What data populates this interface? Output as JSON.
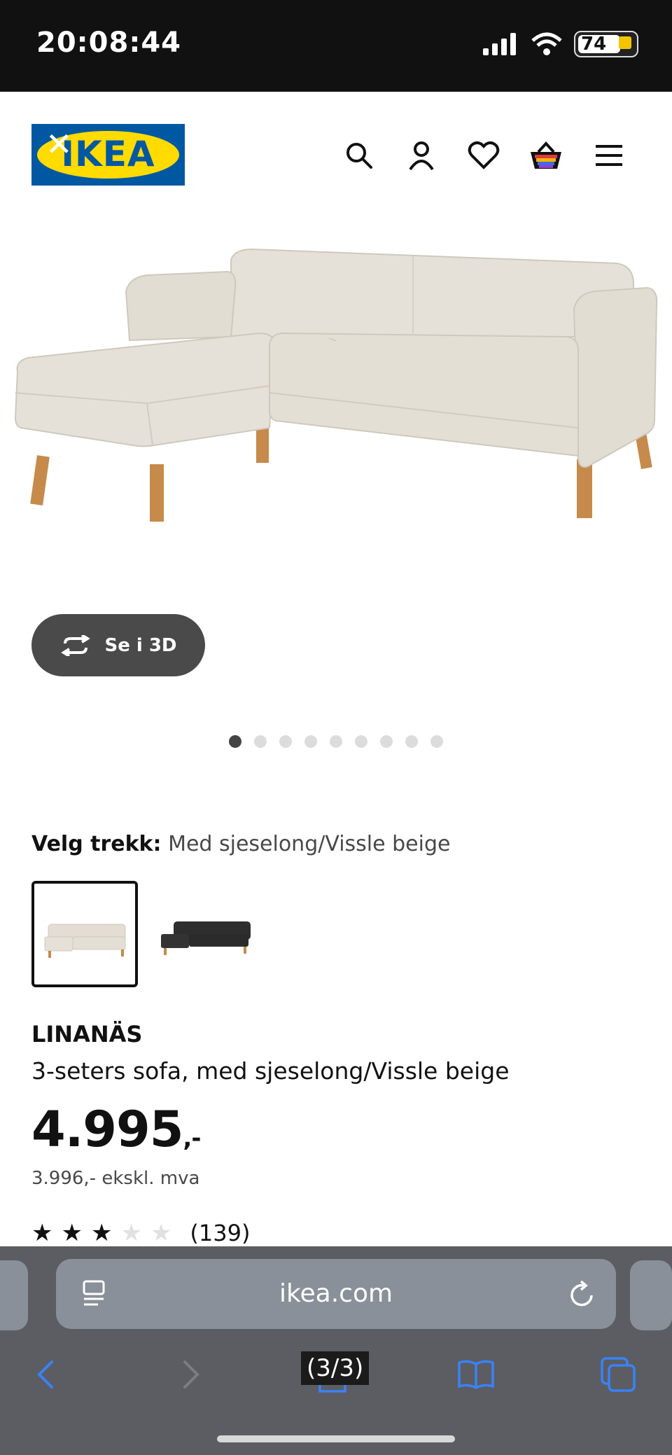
{
  "status_bar": {
    "time": "20:08:44",
    "battery": "74"
  },
  "header": {
    "logo_text": "IKEA",
    "icons": [
      "close-icon",
      "search-icon",
      "account-icon",
      "wishlist-heart-icon",
      "shopping-basket-icon",
      "menu-icon"
    ]
  },
  "gallery": {
    "view_3d_label": "Se i 3D",
    "dot_count": 9,
    "active_dot": 1
  },
  "variant": {
    "label": "Velg trekk:",
    "value": "Med sjeselong/Vissle beige",
    "options": [
      "beige",
      "dark grey"
    ],
    "selected_index": 0
  },
  "product": {
    "name": "LINANÄS",
    "description": "3-seters sofa, med sjeselong/Vissle beige",
    "price_main": "4.995",
    "price_suffix": ",-",
    "price_ex_vat": "3.996,- ekskl. mva",
    "rating_stars": 3,
    "rating_max": 5,
    "reviews": "(139)"
  },
  "browser": {
    "url": "ikea.com",
    "page_indicator": "(3/3)",
    "colors": {
      "accent": "#3a82f7",
      "disabled": "#7a7d84"
    }
  },
  "colors": {
    "ikea_blue": "#0058a3",
    "ikea_yellow": "#ffdb00",
    "sofa_beige": "#e3ddd3",
    "legs": "#c68a4a"
  }
}
